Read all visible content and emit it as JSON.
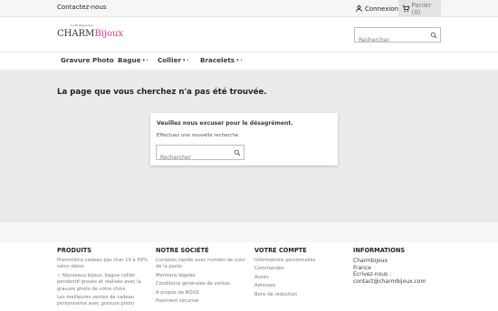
{
  "topbar": {
    "contact": "Contactez-nous",
    "login": "Connexion",
    "cart": "Panier (0)"
  },
  "header": {
    "logo_small": "La Boutique des",
    "logo_charm": "CHARM",
    "logo_bijoux": "Bijoux",
    "search_placeholder": "Rechercher"
  },
  "nav": {
    "items": [
      {
        "label": "Gravure Photo",
        "caret": ""
      },
      {
        "label": "Bague",
        "caret": "▾ ›"
      },
      {
        "label": "Collier",
        "caret": "▾ ›"
      },
      {
        "label": "Bracelets",
        "caret": "▾ ›"
      }
    ]
  },
  "main": {
    "title": "La page que vous cherchez n'a pas été trouvée.",
    "excuse": "Veuillez nous excuser pour le désagrément.",
    "redo": "Effectuez une nouvelle recherche",
    "search_placeholder": "Rechercher"
  },
  "footer": {
    "products": {
      "title": "PRODUITS",
      "links": [
        "Promotions cadeau pas cher 10 à 50% selon dates",
        "✓ Nouveaux bijoux, bague collier pendentif gravés et réalisés avec la gravure photo de votre choix",
        "Les meilleures ventes de cadeau personnalisé avec gravure photo"
      ]
    },
    "company": {
      "title": "NOTRE SOCIÉTÉ",
      "links": [
        "Livraison rapide avec numéro de suivi de la poste",
        "Mentions légales",
        "Conditions générales de ventes",
        "A propos de NOUS",
        "Paiement sécurisé"
      ]
    },
    "account": {
      "title": "VOTRE COMPTE",
      "links": [
        "Informations personnelles",
        "Commandes",
        "Avoirs",
        "Adresses",
        "Bons de réduction"
      ]
    },
    "info": {
      "title": "INFORMATIONS",
      "lines": [
        "Charmbijoux",
        "France",
        "Écrivez-nous :",
        "contact@charmbijoux.com"
      ]
    }
  }
}
